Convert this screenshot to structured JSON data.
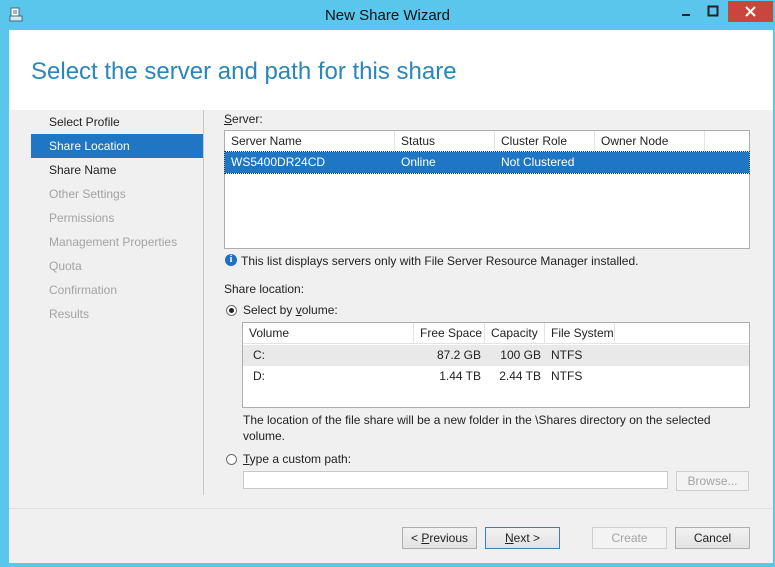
{
  "window": {
    "title": "New Share Wizard",
    "close_color": "#c8463c",
    "frame_color": "#5bc6ec"
  },
  "header": {
    "heading": "Select the server and path for this share"
  },
  "nav": {
    "items": [
      {
        "label": "Select Profile",
        "state": "normal"
      },
      {
        "label": "Share Location",
        "state": "active"
      },
      {
        "label": "Share Name",
        "state": "normal"
      },
      {
        "label": "Other Settings",
        "state": "disabled"
      },
      {
        "label": "Permissions",
        "state": "disabled"
      },
      {
        "label": "Management Properties",
        "state": "disabled"
      },
      {
        "label": "Quota",
        "state": "disabled"
      },
      {
        "label": "Confirmation",
        "state": "disabled"
      },
      {
        "label": "Results",
        "state": "disabled"
      }
    ]
  },
  "server": {
    "label_pre": "",
    "label_u": "S",
    "label_post": "erver:",
    "columns": [
      "Server Name",
      "Status",
      "Cluster Role",
      "Owner Node"
    ],
    "rows": [
      {
        "name": "WS5400DR24CD",
        "status": "Online",
        "cluster_role": "Not Clustered",
        "owner_node": ""
      }
    ],
    "info": "This list displays servers only with File Server Resource Manager installed."
  },
  "location": {
    "label": "Share location:",
    "by_volume_pre": "Select by ",
    "by_volume_u": "v",
    "by_volume_post": "olume:",
    "volume_columns": [
      "Volume",
      "Free Space",
      "Capacity",
      "File System"
    ],
    "volumes": [
      {
        "volume": "C:",
        "free": "87.2 GB",
        "capacity": "100 GB",
        "fs": "NTFS"
      },
      {
        "volume": "D:",
        "free": "1.44 TB",
        "capacity": "2.44 TB",
        "fs": "NTFS"
      }
    ],
    "note": "The location of the file share will be a new folder in the \\Shares directory on the selected volume.",
    "custom_u": "T",
    "custom_post": "ype a custom path:",
    "custom_value": "",
    "browse": "Browse..."
  },
  "footer": {
    "previous_pre": "< ",
    "previous_u": "P",
    "previous_post": "revious",
    "next_u": "N",
    "next_post": "ext >",
    "create": "Create",
    "cancel": "Cancel"
  },
  "colors": {
    "accent": "#1e76c4",
    "heading": "#2a86b9"
  }
}
